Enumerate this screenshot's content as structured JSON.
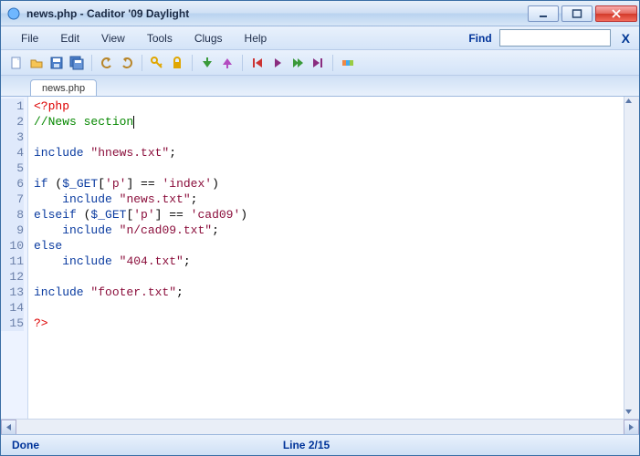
{
  "window": {
    "title": "news.php - Caditor '09 Daylight"
  },
  "menubar": {
    "file": "File",
    "edit": "Edit",
    "view": "View",
    "tools": "Tools",
    "clugs": "Clugs",
    "help": "Help",
    "find_label": "Find",
    "find_value": "",
    "find_close": "X"
  },
  "tabs": [
    {
      "label": "news.php"
    }
  ],
  "code": {
    "lines": [
      {
        "n": 1,
        "segs": [
          {
            "t": "<?php",
            "c": "k-tag"
          }
        ]
      },
      {
        "n": 2,
        "segs": [
          {
            "t": "//News section",
            "c": "k-comment"
          }
        ],
        "caret": true
      },
      {
        "n": 3,
        "segs": []
      },
      {
        "n": 4,
        "segs": [
          {
            "t": "include",
            "c": "k-kw"
          },
          {
            "t": " "
          },
          {
            "t": "\"hnews.txt\"",
            "c": "k-str"
          },
          {
            "t": ";"
          }
        ]
      },
      {
        "n": 5,
        "segs": []
      },
      {
        "n": 6,
        "segs": [
          {
            "t": "if",
            "c": "k-kw"
          },
          {
            "t": " ("
          },
          {
            "t": "$_GET",
            "c": "k-var"
          },
          {
            "t": "["
          },
          {
            "t": "'p'",
            "c": "k-idx"
          },
          {
            "t": "] == "
          },
          {
            "t": "'index'",
            "c": "k-idx"
          },
          {
            "t": ")"
          }
        ]
      },
      {
        "n": 7,
        "segs": [
          {
            "t": "    "
          },
          {
            "t": "include",
            "c": "k-kw"
          },
          {
            "t": " "
          },
          {
            "t": "\"news.txt\"",
            "c": "k-str"
          },
          {
            "t": ";"
          }
        ]
      },
      {
        "n": 8,
        "segs": [
          {
            "t": "elseif",
            "c": "k-kw"
          },
          {
            "t": " ("
          },
          {
            "t": "$_GET",
            "c": "k-var"
          },
          {
            "t": "["
          },
          {
            "t": "'p'",
            "c": "k-idx"
          },
          {
            "t": "] == "
          },
          {
            "t": "'cad09'",
            "c": "k-idx"
          },
          {
            "t": ")"
          }
        ]
      },
      {
        "n": 9,
        "segs": [
          {
            "t": "    "
          },
          {
            "t": "include",
            "c": "k-kw"
          },
          {
            "t": " "
          },
          {
            "t": "\"n/cad09.txt\"",
            "c": "k-str"
          },
          {
            "t": ";"
          }
        ]
      },
      {
        "n": 10,
        "segs": [
          {
            "t": "else",
            "c": "k-kw"
          }
        ]
      },
      {
        "n": 11,
        "segs": [
          {
            "t": "    "
          },
          {
            "t": "include",
            "c": "k-kw"
          },
          {
            "t": " "
          },
          {
            "t": "\"404.txt\"",
            "c": "k-str"
          },
          {
            "t": ";"
          }
        ]
      },
      {
        "n": 12,
        "segs": []
      },
      {
        "n": 13,
        "segs": [
          {
            "t": "include",
            "c": "k-kw"
          },
          {
            "t": " "
          },
          {
            "t": "\"footer.txt\"",
            "c": "k-str"
          },
          {
            "t": ";"
          }
        ]
      },
      {
        "n": 14,
        "segs": []
      },
      {
        "n": 15,
        "segs": [
          {
            "t": "?>",
            "c": "k-tag"
          }
        ]
      }
    ]
  },
  "status": {
    "left": "Done",
    "center": "Line 2/15"
  },
  "icons": {
    "toolbar": [
      "new-icon",
      "open-icon",
      "save-icon",
      "save-all-icon",
      "sep",
      "undo-icon",
      "redo-icon",
      "sep",
      "key-icon",
      "lock-icon",
      "sep",
      "arrow-down-icon",
      "arrow-up-icon",
      "sep",
      "first-icon",
      "play-prev-icon",
      "play-next-icon",
      "last-icon",
      "sep",
      "highlight-icon"
    ]
  }
}
